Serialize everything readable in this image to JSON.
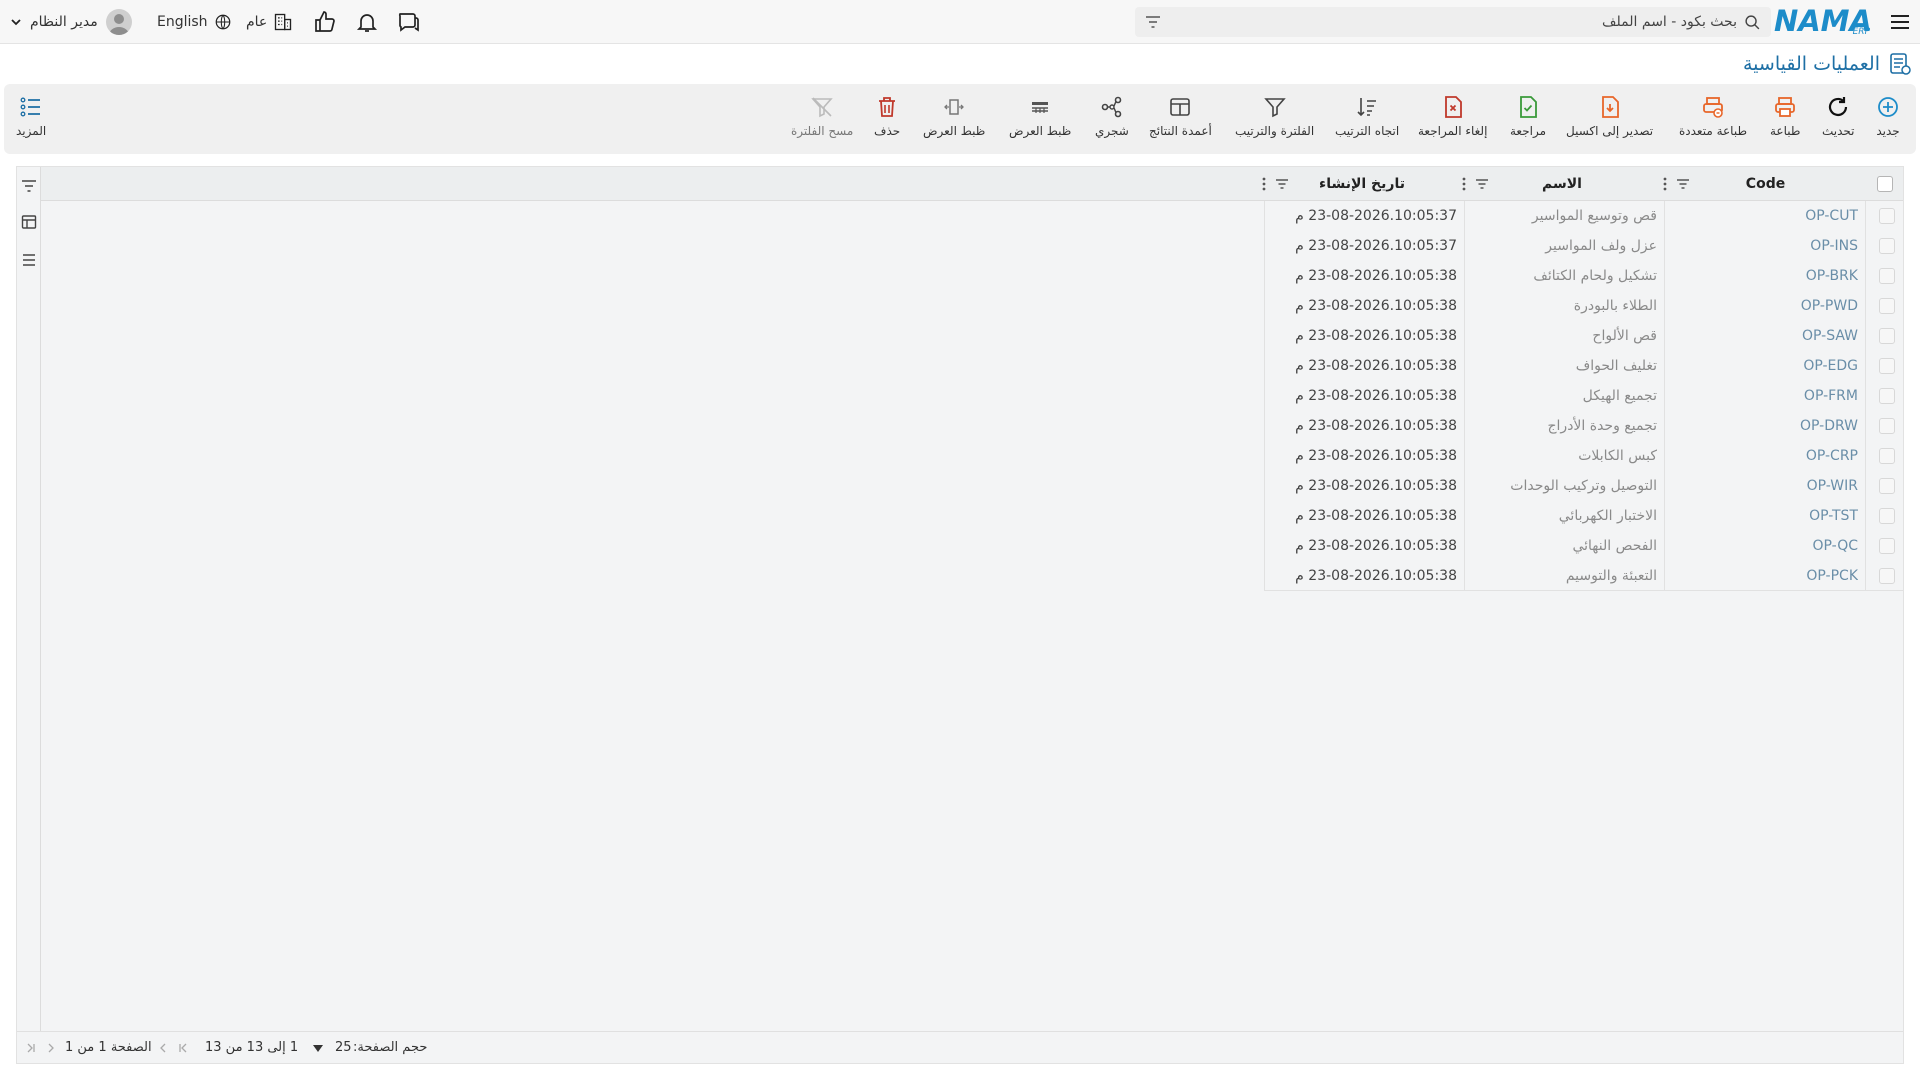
{
  "header": {
    "logo_text": "NAMA",
    "logo_sub": "ERP",
    "search_placeholder": "بحث بكود - اسم الملف",
    "general_label": "عام",
    "language_label": "English",
    "user_name": "مدير النظام"
  },
  "page": {
    "title": "العمليات القياسية"
  },
  "toolbar": {
    "new": "جديد",
    "refresh": "تحديث",
    "print": "طباعة",
    "multi_print": "طباعة متعددة",
    "export_excel": "تصدير إلى اكسيل",
    "review": "مراجعة",
    "cancel_review": "إلغاء المراجعة",
    "sort_direction": "اتجاه الترتيب",
    "filter_sort": "الفلترة والترتيب",
    "result_columns": "أعمدة النتائج",
    "tree": "شجري",
    "view_settings_1": "ظبط العرض",
    "view_settings_2": "ظبط العرض",
    "delete": "حذف",
    "clear_filter": "مسح الفلترة",
    "more": "المزيد"
  },
  "grid": {
    "columns": {
      "code": "Code",
      "name": "الاسم",
      "created": "تاريخ الإنشاء"
    },
    "rows": [
      {
        "code": "OP-CUT",
        "name": "قص وتوسيع المواسير",
        "created": "23-08-2026.10:05:37 م"
      },
      {
        "code": "OP-INS",
        "name": "عزل ولف المواسير",
        "created": "23-08-2026.10:05:37 م"
      },
      {
        "code": "OP-BRK",
        "name": "تشكيل ولحام الكتائف",
        "created": "23-08-2026.10:05:38 م"
      },
      {
        "code": "OP-PWD",
        "name": "الطلاء بالبودرة",
        "created": "23-08-2026.10:05:38 م"
      },
      {
        "code": "OP-SAW",
        "name": "قص الألواح",
        "created": "23-08-2026.10:05:38 م"
      },
      {
        "code": "OP-EDG",
        "name": "تغليف الحواف",
        "created": "23-08-2026.10:05:38 م"
      },
      {
        "code": "OP-FRM",
        "name": "تجميع الهيكل",
        "created": "23-08-2026.10:05:38 م"
      },
      {
        "code": "OP-DRW",
        "name": "تجميع وحدة الأدراج",
        "created": "23-08-2026.10:05:38 م"
      },
      {
        "code": "OP-CRP",
        "name": "كبس الكابلات",
        "created": "23-08-2026.10:05:38 م"
      },
      {
        "code": "OP-WIR",
        "name": "التوصيل وتركيب الوحدات",
        "created": "23-08-2026.10:05:38 م"
      },
      {
        "code": "OP-TST",
        "name": "الاختبار الكهربائي",
        "created": "23-08-2026.10:05:38 م"
      },
      {
        "code": "OP-QC",
        "name": "الفحص النهائي",
        "created": "23-08-2026.10:05:38 م"
      },
      {
        "code": "OP-PCK",
        "name": "التعبئة والتوسيم",
        "created": "23-08-2026.10:05:38 م"
      }
    ]
  },
  "footer": {
    "page_size_label": "حجم الصفحة:",
    "page_size_value": "25",
    "range_text": "1 إلى 13 من 13",
    "page_text": "الصفحة 1 من 1"
  },
  "colors": {
    "brand": "#1d8cc9",
    "title": "#1d6fa5",
    "orange": "#e8662a",
    "green": "#3a9a3a",
    "red": "#c0392b"
  }
}
